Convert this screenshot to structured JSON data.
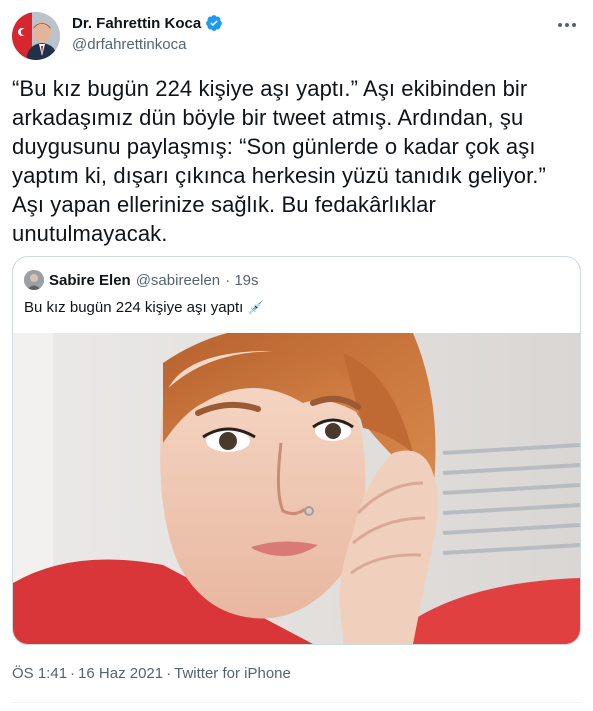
{
  "author": {
    "name": "Dr. Fahrettin Koca",
    "handle": "@drfahrettinkoca"
  },
  "tweet": {
    "text": "“Bu kız bugün 224 kişiye aşı yaptı.” Aşı ekibinden bir\narkadaşımız dün böyle bir tweet atmış. Ardından, şu\nduygusunu paylaşmış: “Son günlerde o kadar çok aşı\nyaptım ki, dışarı çıkınca herkesin yüzü tanıdık geliyor.”\nAşı yapan ellerinize sağlık. Bu fedakârlıklar\nunutulmayacak."
  },
  "quoted": {
    "name": "Sabire Elen",
    "handle": "@sabireelen",
    "time": "· 19s",
    "text": "Bu kız bugün 224 kişiye aşı yaptı",
    "emoji": "💉"
  },
  "footer": {
    "time": "ÖS 1:41",
    "date": "16 Haz 2021",
    "source": "Twitter for iPhone"
  },
  "icons": {
    "verified": "verified-badge-icon",
    "more": "more-options-icon",
    "syringe": "syringe-icon"
  },
  "colors": {
    "verified_blue": "#1d9bf0",
    "secondary_text": "#536471",
    "border": "#cfd9de"
  }
}
